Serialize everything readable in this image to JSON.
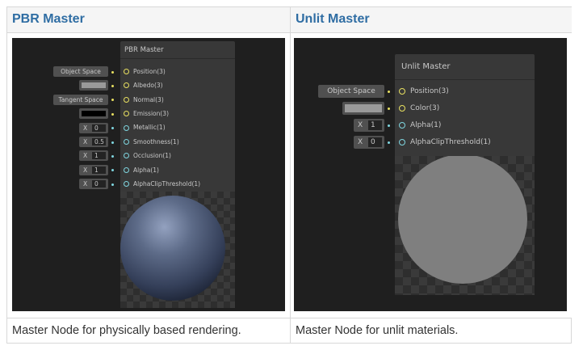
{
  "table": {
    "left_header": "PBR Master",
    "right_header": "Unlit Master",
    "left_caption": "Master Node for physically based rendering.",
    "right_caption": "Master Node for unlit materials."
  },
  "pbr": {
    "title": "PBR Master",
    "ports": [
      {
        "label": "Position(3)",
        "input": "Object Space",
        "kind": "dropdown",
        "color": "yellow"
      },
      {
        "label": "Albedo(3)",
        "input": "",
        "kind": "gray-swatch",
        "color": "yellow"
      },
      {
        "label": "Normal(3)",
        "input": "Tangent Space",
        "kind": "dropdown",
        "color": "yellow"
      },
      {
        "label": "Emission(3)",
        "input": "",
        "kind": "black-swatch",
        "color": "yellow"
      },
      {
        "label": "Metallic(1)",
        "input_prefix": "X",
        "input": "0",
        "kind": "number",
        "color": "cyan"
      },
      {
        "label": "Smoothness(1)",
        "input_prefix": "X",
        "input": "0.5",
        "kind": "number",
        "color": "cyan"
      },
      {
        "label": "Occlusion(1)",
        "input_prefix": "X",
        "input": "1",
        "kind": "number",
        "color": "cyan"
      },
      {
        "label": "Alpha(1)",
        "input_prefix": "X",
        "input": "1",
        "kind": "number",
        "color": "cyan"
      },
      {
        "label": "AlphaClipThreshold(1)",
        "input_prefix": "X",
        "input": "0",
        "kind": "number",
        "color": "cyan"
      }
    ]
  },
  "unlit": {
    "title": "Unlit Master",
    "ports": [
      {
        "label": "Position(3)",
        "input": "Object Space",
        "kind": "dropdown",
        "color": "yellow"
      },
      {
        "label": "Color(3)",
        "input": "",
        "kind": "gray-swatch",
        "color": "yellow"
      },
      {
        "label": "Alpha(1)",
        "input_prefix": "X",
        "input": "1",
        "kind": "number",
        "color": "cyan"
      },
      {
        "label": "AlphaClipThreshold(1)",
        "input_prefix": "X",
        "input": "0",
        "kind": "number",
        "color": "cyan"
      }
    ]
  },
  "colors": {
    "header_text": "#2f6da3",
    "port_yellow": "#e8e060",
    "port_cyan": "#7fd6e0",
    "unlit_sphere": "#7f7f7f",
    "pbr_sphere": "#4a5670"
  }
}
